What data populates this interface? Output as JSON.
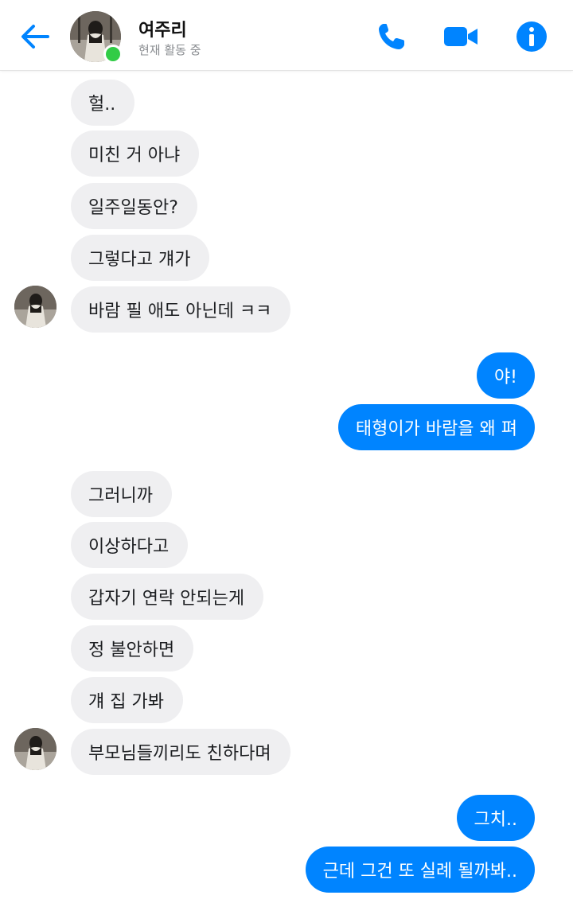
{
  "header": {
    "contact_name": "여주리",
    "status": "현재 활동 중",
    "icons": [
      "back-arrow-icon",
      "phone-icon",
      "video-camera-icon",
      "info-icon"
    ],
    "accent_color": "#0084ff",
    "online_color": "#31cc46"
  },
  "messages": [
    {
      "side": "in",
      "text": "헐.."
    },
    {
      "side": "in",
      "text": "미친 거 아냐"
    },
    {
      "side": "in",
      "text": "일주일동안?"
    },
    {
      "side": "in",
      "text": "그렇다고 걔가"
    },
    {
      "side": "in",
      "text": "바람 필 애도 아닌데 ㅋㅋ"
    },
    {
      "side": "out",
      "text": "야!"
    },
    {
      "side": "out",
      "text": "태형이가 바람을 왜 펴"
    },
    {
      "side": "in",
      "text": "그러니까"
    },
    {
      "side": "in",
      "text": "이상하다고"
    },
    {
      "side": "in",
      "text": "갑자기 연락 안되는게"
    },
    {
      "side": "in",
      "text": "정 불안하면"
    },
    {
      "side": "in",
      "text": "걔 집 가봐"
    },
    {
      "side": "in",
      "text": "부모님들끼리도 친하다며"
    },
    {
      "side": "out",
      "text": "그치.."
    },
    {
      "side": "out",
      "text": "근데 그건 또 실례 될까봐.."
    }
  ]
}
